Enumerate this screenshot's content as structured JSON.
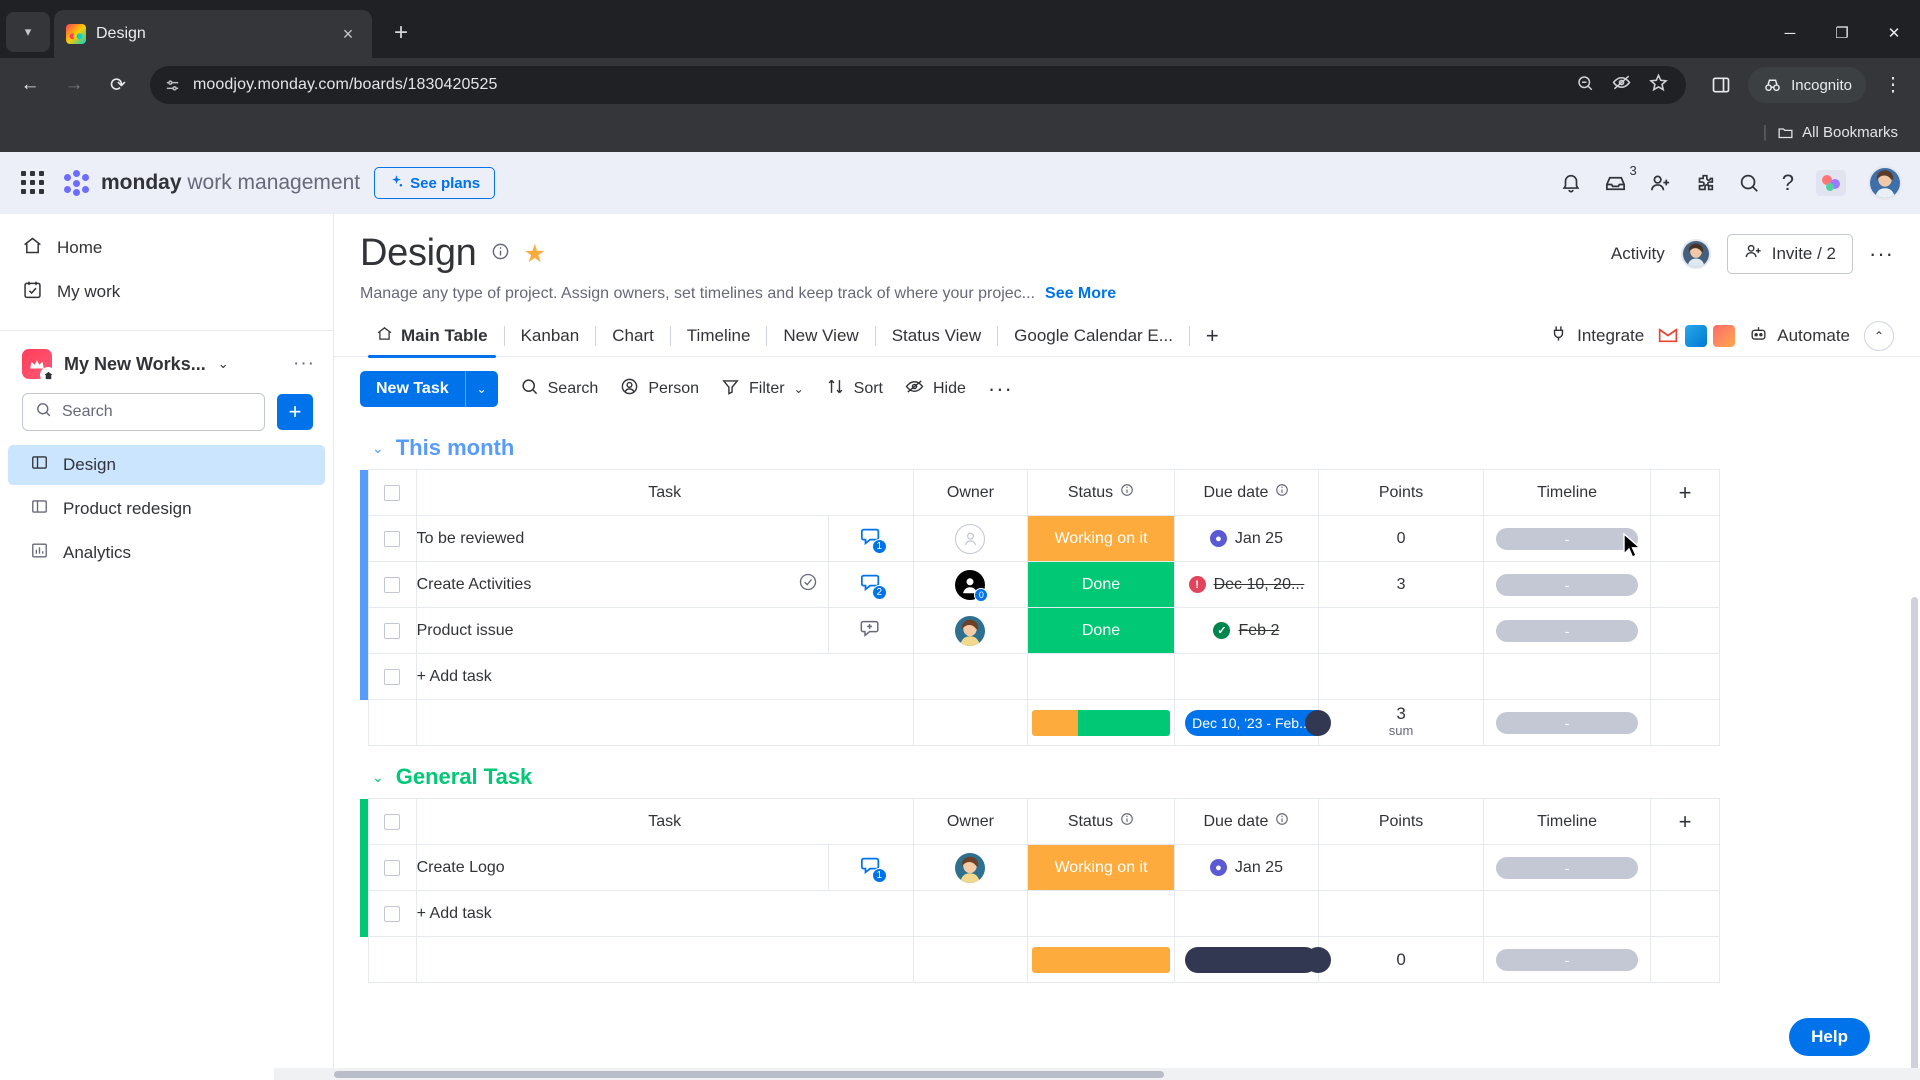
{
  "browser": {
    "tab": {
      "title": "Design",
      "favicon": "monday-logo-icon",
      "close": "×"
    },
    "newtab_label": "+",
    "nav": {
      "back": "←",
      "forward": "→",
      "reload": "⟳"
    },
    "omnibox": {
      "url": "moodjoy.monday.com/boards/1830420525",
      "site_icon": "site-settings-icon"
    },
    "omni_right_icons": [
      "zoom-icon",
      "eye-off-icon",
      "star-icon"
    ],
    "side_panel_icon": "side-panel-icon",
    "incognito_label": "Incognito",
    "menu_icon": "⋮",
    "window_controls": {
      "minimize": "─",
      "maximize": "❐",
      "close": "✕"
    },
    "bookmarks": {
      "separator": "|",
      "all_bookmarks": "All Bookmarks",
      "folder_icon": "folder-icon"
    }
  },
  "app_header": {
    "brand_bold": "monday",
    "brand_rest": " work management",
    "see_plans": "See plans",
    "see_plans_icon": "sparkle-icon",
    "waffle_icon": "apps-grid-icon",
    "icons": {
      "notifications": "bell-icon",
      "inbox": "inbox-icon",
      "inbox_badge": "3",
      "invite": "person-add-icon",
      "marketplace": "puzzle-icon",
      "search": "search-icon",
      "help": "?",
      "theme": "theme-icon",
      "profile": "profile-avatar"
    }
  },
  "sidebar": {
    "links": [
      {
        "label": "Home",
        "icon": "home-icon"
      },
      {
        "label": "My work",
        "icon": "calendar-check-icon"
      }
    ],
    "workspace": {
      "name": "My New Works...",
      "avatar_icon": "crown-icon",
      "chevron": "⌄",
      "more": "···"
    },
    "search_placeholder": "Search",
    "add_button": "+",
    "boards": [
      {
        "label": "Design",
        "icon": "board-icon",
        "active": true
      },
      {
        "label": "Product redesign",
        "icon": "board-icon",
        "active": false
      },
      {
        "label": "Analytics",
        "icon": "dashboard-icon",
        "active": false
      }
    ]
  },
  "board": {
    "title": "Design",
    "info_icon": "info-icon",
    "star_icon": "★",
    "activity_label": "Activity",
    "activity_avatar": "activity-avatar",
    "invite_label": "Invite / 2",
    "invite_icon": "person-add-icon",
    "more_icon": "···",
    "description": "Manage any type of project. Assign owners, set timelines and keep track of where your projec...",
    "see_more": "See More",
    "views": [
      {
        "label": "Main Table",
        "icon": "home-icon",
        "active": true
      },
      {
        "label": "Kanban",
        "active": false
      },
      {
        "label": "Chart",
        "active": false
      },
      {
        "label": "Timeline",
        "active": false
      },
      {
        "label": "New View",
        "active": false
      },
      {
        "label": "Status View",
        "active": false
      },
      {
        "label": "Google Calendar E...",
        "active": false
      }
    ],
    "add_view": "+",
    "integrate_label": "Integrate",
    "integrate_icon": "plug-icon",
    "integration_apps": [
      "gmail-icon",
      "outlook-icon",
      "calendar-icon"
    ],
    "automate_label": "Automate",
    "automate_icon": "robot-icon",
    "collapse_icon": "⌃"
  },
  "toolbar": {
    "new_task": "New Task",
    "new_task_chevron": "⌄",
    "items": [
      {
        "label": "Search",
        "icon": "search-icon"
      },
      {
        "label": "Person",
        "icon": "person-icon"
      },
      {
        "label": "Filter",
        "icon": "filter-icon",
        "chevron": "⌄"
      },
      {
        "label": "Sort",
        "icon": "sort-icon"
      },
      {
        "label": "Hide",
        "icon": "eye-off-icon"
      }
    ],
    "more": "···"
  },
  "table": {
    "columns": [
      "Task",
      "Owner",
      "Status",
      "Due date",
      "Points",
      "Timeline"
    ],
    "add_column": "+",
    "add_task_label": "+ Add task",
    "status_info_icon": "info-icon",
    "date_info_icon": "info-icon",
    "timeline_placeholder": "-"
  },
  "groups": [
    {
      "name": "This month",
      "color": "#579bfc",
      "chevron": "⌄",
      "rows": [
        {
          "task": "To be reviewed",
          "updates": "1",
          "owner_type": "empty",
          "status": "Working on it",
          "status_color": "#fdab3d",
          "due_date": "Jan 25",
          "due_dot": "dark",
          "due_strike": false,
          "points": "0",
          "timeline": "-",
          "task_icon": null
        },
        {
          "task": "Create Activities",
          "updates": "2",
          "owner_type": "dark",
          "owner_badge": "0",
          "status": "Done",
          "status_color": "#00c875",
          "due_date": "Dec 10, 20...",
          "due_dot": "red",
          "due_strike": true,
          "points": "3",
          "timeline": "-",
          "task_icon": "check-circle-icon"
        },
        {
          "task": "Product issue",
          "updates": null,
          "updates_icon": "add-update-icon",
          "owner_type": "photo",
          "status": "Done",
          "status_color": "#00c875",
          "due_date": "Feb 2",
          "due_dot": "green",
          "due_strike": true,
          "points": "",
          "timeline": "-",
          "task_icon": null
        }
      ],
      "summary": {
        "status_segments": [
          {
            "color": "#fdab3d",
            "ratio": 33
          },
          {
            "color": "#00c875",
            "ratio": 67
          }
        ],
        "date_range": "Dec 10, '23 - Feb...",
        "points_value": "3",
        "points_label": "sum",
        "timeline": "-"
      }
    },
    {
      "name": "General Task",
      "color": "#00c875",
      "chevron": "⌄",
      "rows": [
        {
          "task": "Create Logo",
          "updates": "1",
          "owner_type": "photo",
          "status": "Working on it",
          "status_color": "#fdab3d",
          "due_date": "Jan 25",
          "due_dot": "dark",
          "due_strike": false,
          "points": "",
          "timeline": "-",
          "task_icon": null
        }
      ]
    }
  ],
  "help_button": "Help"
}
